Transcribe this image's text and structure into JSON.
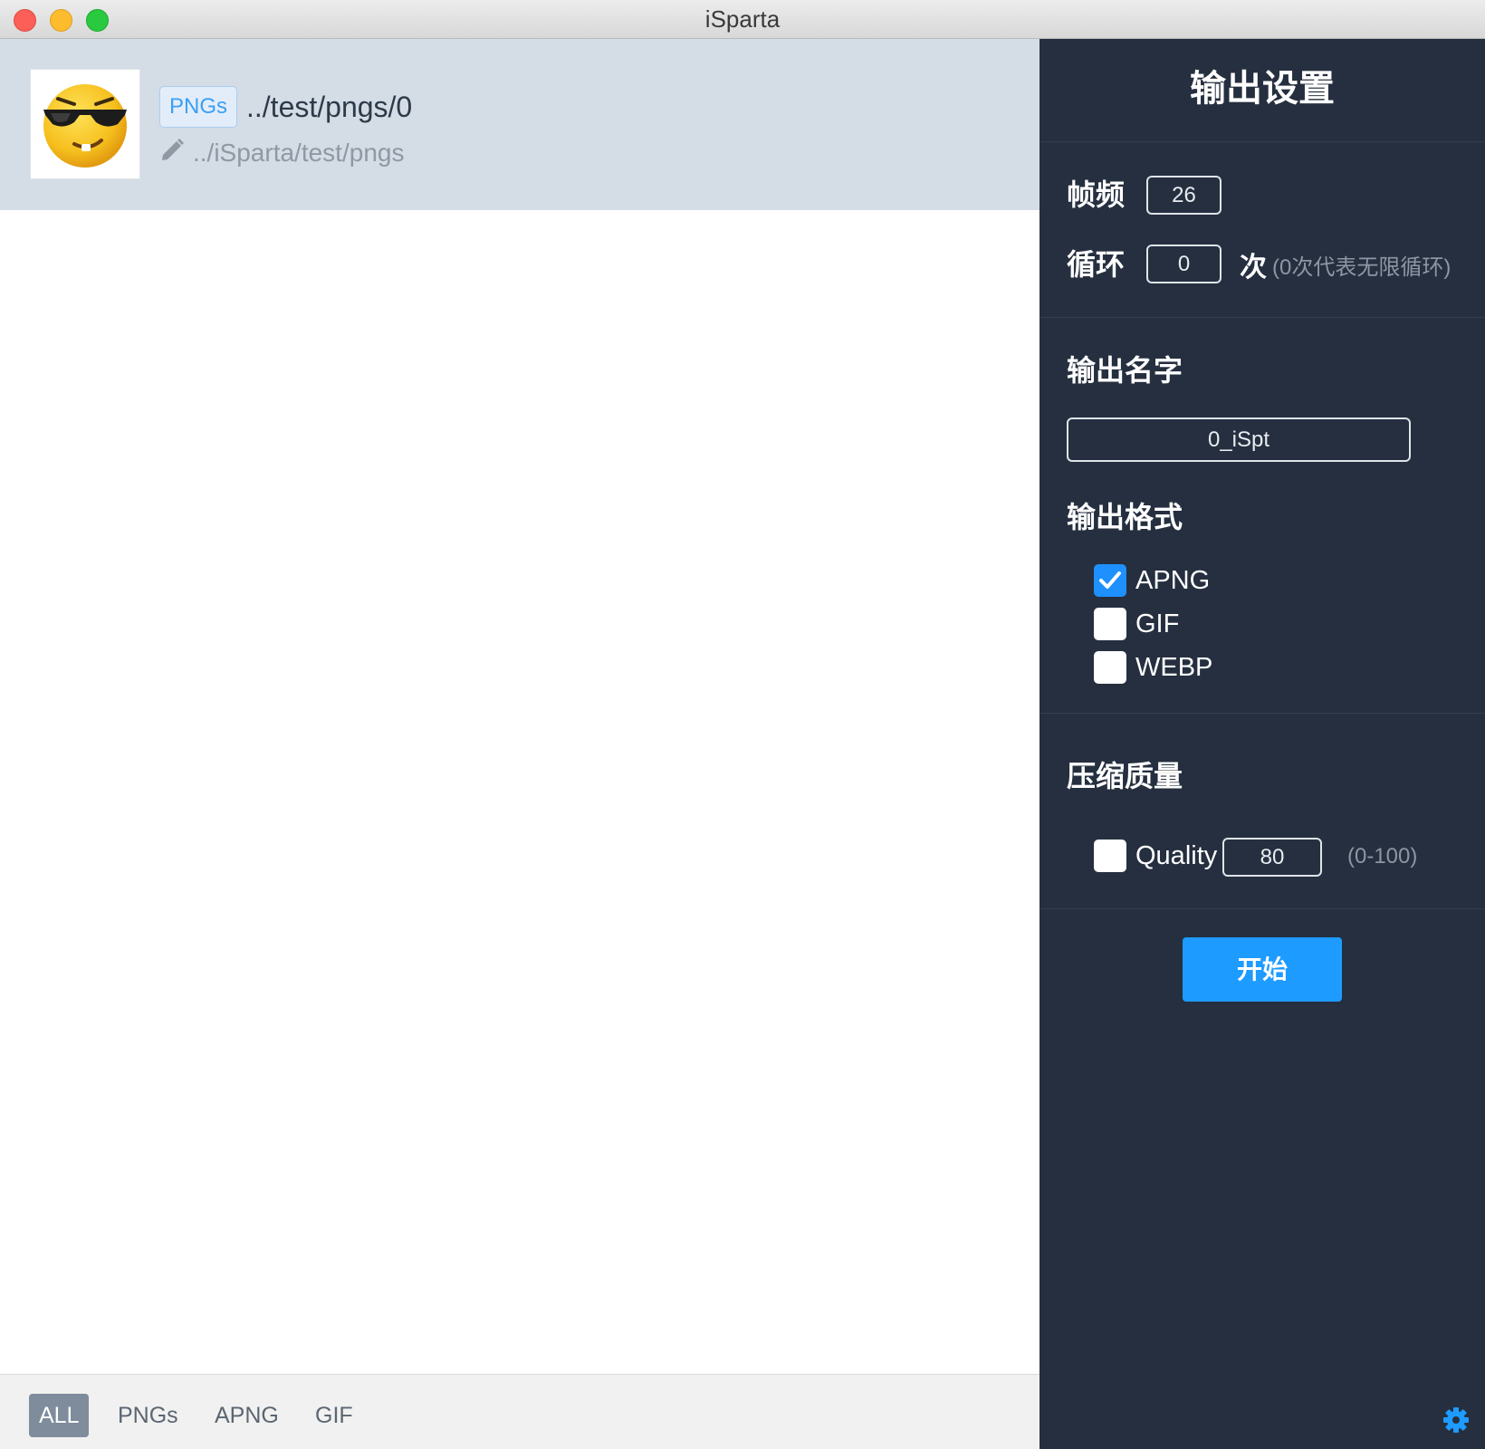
{
  "window": {
    "title": "iSparta"
  },
  "item": {
    "tag": "PNGs",
    "name": "../test/pngs/0",
    "path": "../iSparta/test/pngs",
    "thumbnail_icon": "sunglasses-emoji-icon",
    "edit_icon": "pencil-icon"
  },
  "tabs": [
    {
      "label": "ALL",
      "active": true
    },
    {
      "label": "PNGs",
      "active": false
    },
    {
      "label": "APNG",
      "active": false
    },
    {
      "label": "GIF",
      "active": false
    }
  ],
  "settings": {
    "title": "输出设置",
    "framerate": {
      "label": "帧频",
      "value": "26"
    },
    "loop": {
      "label": "循环",
      "value": "0",
      "unit": "次",
      "hint": "(0次代表无限循环)"
    },
    "output_name": {
      "label": "输出名字",
      "value": "0_iSpt"
    },
    "output_format": {
      "label": "输出格式",
      "options": [
        {
          "label": "APNG",
          "checked": true
        },
        {
          "label": "GIF",
          "checked": false
        },
        {
          "label": "WEBP",
          "checked": false
        }
      ]
    },
    "quality": {
      "label": "压缩质量",
      "option_label": "Quality",
      "checked": false,
      "value": "80",
      "hint": "(0-100)"
    },
    "start_label": "开始",
    "settings_icon": "gear-icon"
  },
  "colors": {
    "accent": "#1e9bff",
    "panel_bg": "#252f3f",
    "item_bg": "#d4dce6"
  }
}
